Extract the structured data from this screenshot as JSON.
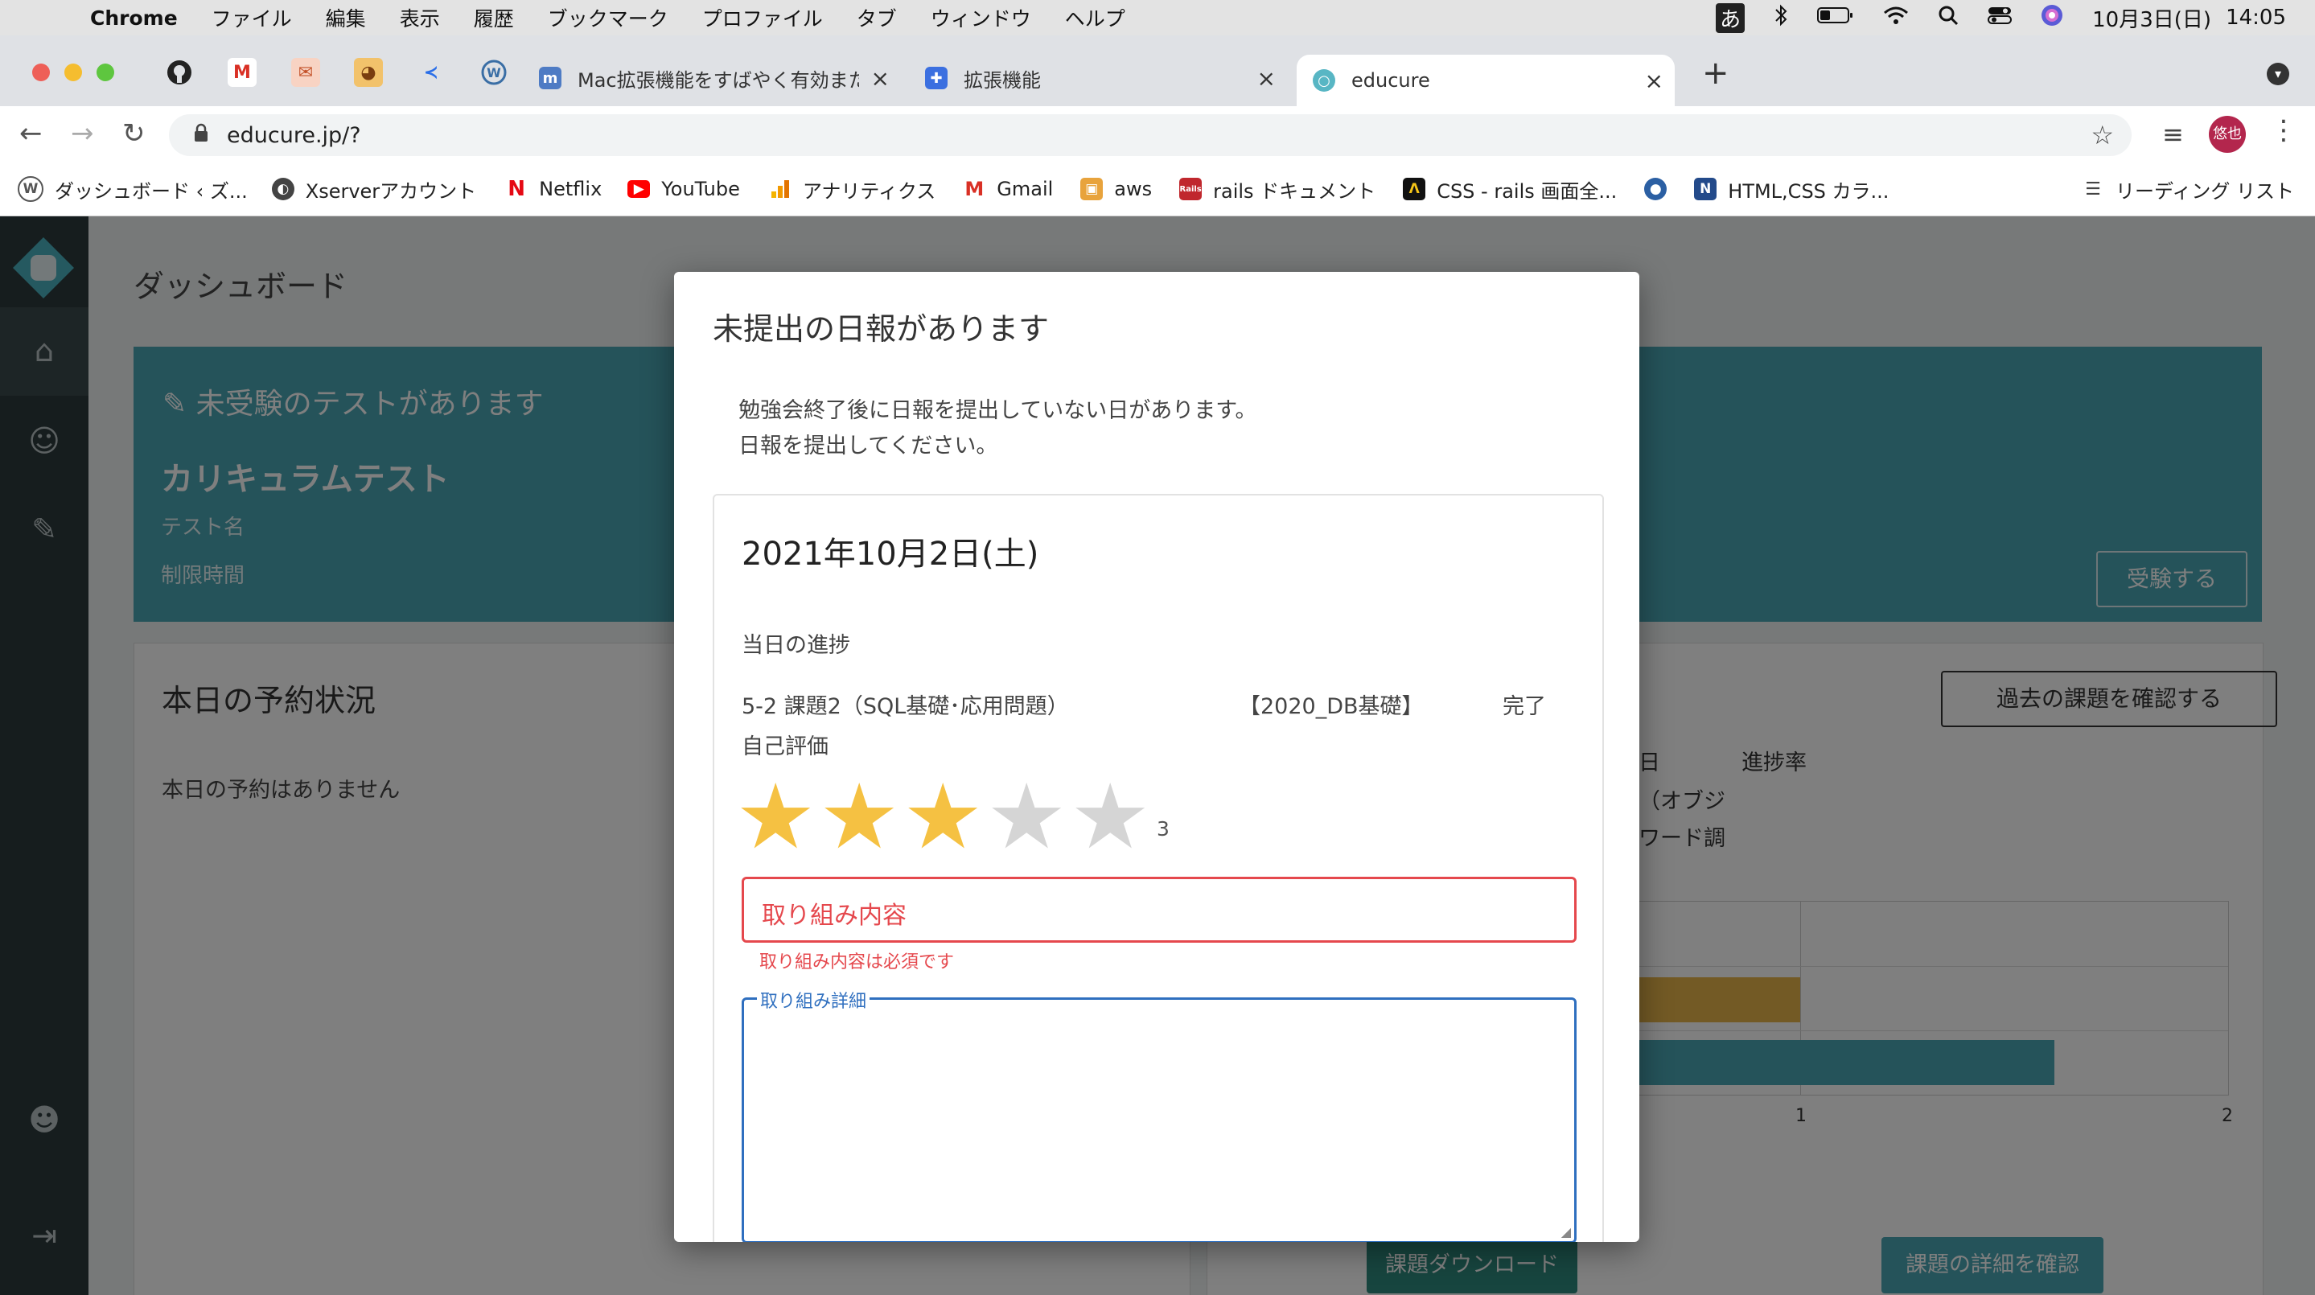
{
  "menubar": {
    "app": "Chrome",
    "items": [
      "ファイル",
      "編集",
      "表示",
      "履歴",
      "ブックマーク",
      "プロファイル",
      "タブ",
      "ウィンドウ",
      "ヘルプ"
    ],
    "ime": "あ",
    "datetime": "10月3日(日)",
    "time": "14:05"
  },
  "tabs": {
    "items": [
      {
        "label": "Mac拡張機能をすばやく有効またはを",
        "active": false
      },
      {
        "label": "拡張機能",
        "active": false
      },
      {
        "label": "educure",
        "active": true
      }
    ],
    "new_tab": "+"
  },
  "address": {
    "url": "educure.jp/?",
    "profile": "悠也"
  },
  "bookmarks": {
    "items": [
      "ダッシュボード ‹ ズ...",
      "Xserverアカウント",
      "Netflix",
      "YouTube",
      "アナリティクス",
      "Gmail",
      "aws",
      "rails ドキュメント",
      "CSS - rails 画面全...",
      "HTML,CSS カラ..."
    ],
    "reading_list": "リーディング リスト"
  },
  "dashboard": {
    "title": "ダッシュボード",
    "test_banner": {
      "heading": "未受験のテストがあります",
      "test_title": "カリキュラムテスト",
      "name_label": "テスト名",
      "time_label": "制限時間",
      "take_button": "受験する"
    },
    "reservation": {
      "title": "本日の予約状況",
      "empty": "本日の予約はありません"
    },
    "tasks": {
      "past_button": "過去の課題を確認する",
      "col_progress": "進捗率",
      "col_frag": "日",
      "row1": "（オブジ",
      "row2": "ワード調",
      "axis": [
        "1",
        "2"
      ],
      "download_button": "課題ダウンロード",
      "detail_button": "課題の詳細を確認"
    }
  },
  "modal": {
    "title": "未提出の日報があります",
    "message_line1": "勉強会終了後に日報を提出していない日があります。",
    "message_line2": "日報を提出してください。",
    "report": {
      "date": "2021年10月2日(土)",
      "progress_label": "当日の進捗",
      "task": "5-2 課題2（SQL基礎･応用問題）",
      "course": "【2020_DB基礎】",
      "status": "完了",
      "self_eval_label": "自己評価",
      "rating": 3,
      "rating_max": 5,
      "rating_text": "3",
      "content_placeholder": "取り組み内容",
      "content_error": "取り組み内容は必須です",
      "detail_label": "取り組み詳細"
    }
  },
  "colors": {
    "teal": "#4aa7b5",
    "sidebar": "#2d3a3c",
    "star_on": "#f5c142",
    "star_off": "#d5d5d5",
    "error": "#e5484d",
    "focus": "#2f6fbf"
  }
}
